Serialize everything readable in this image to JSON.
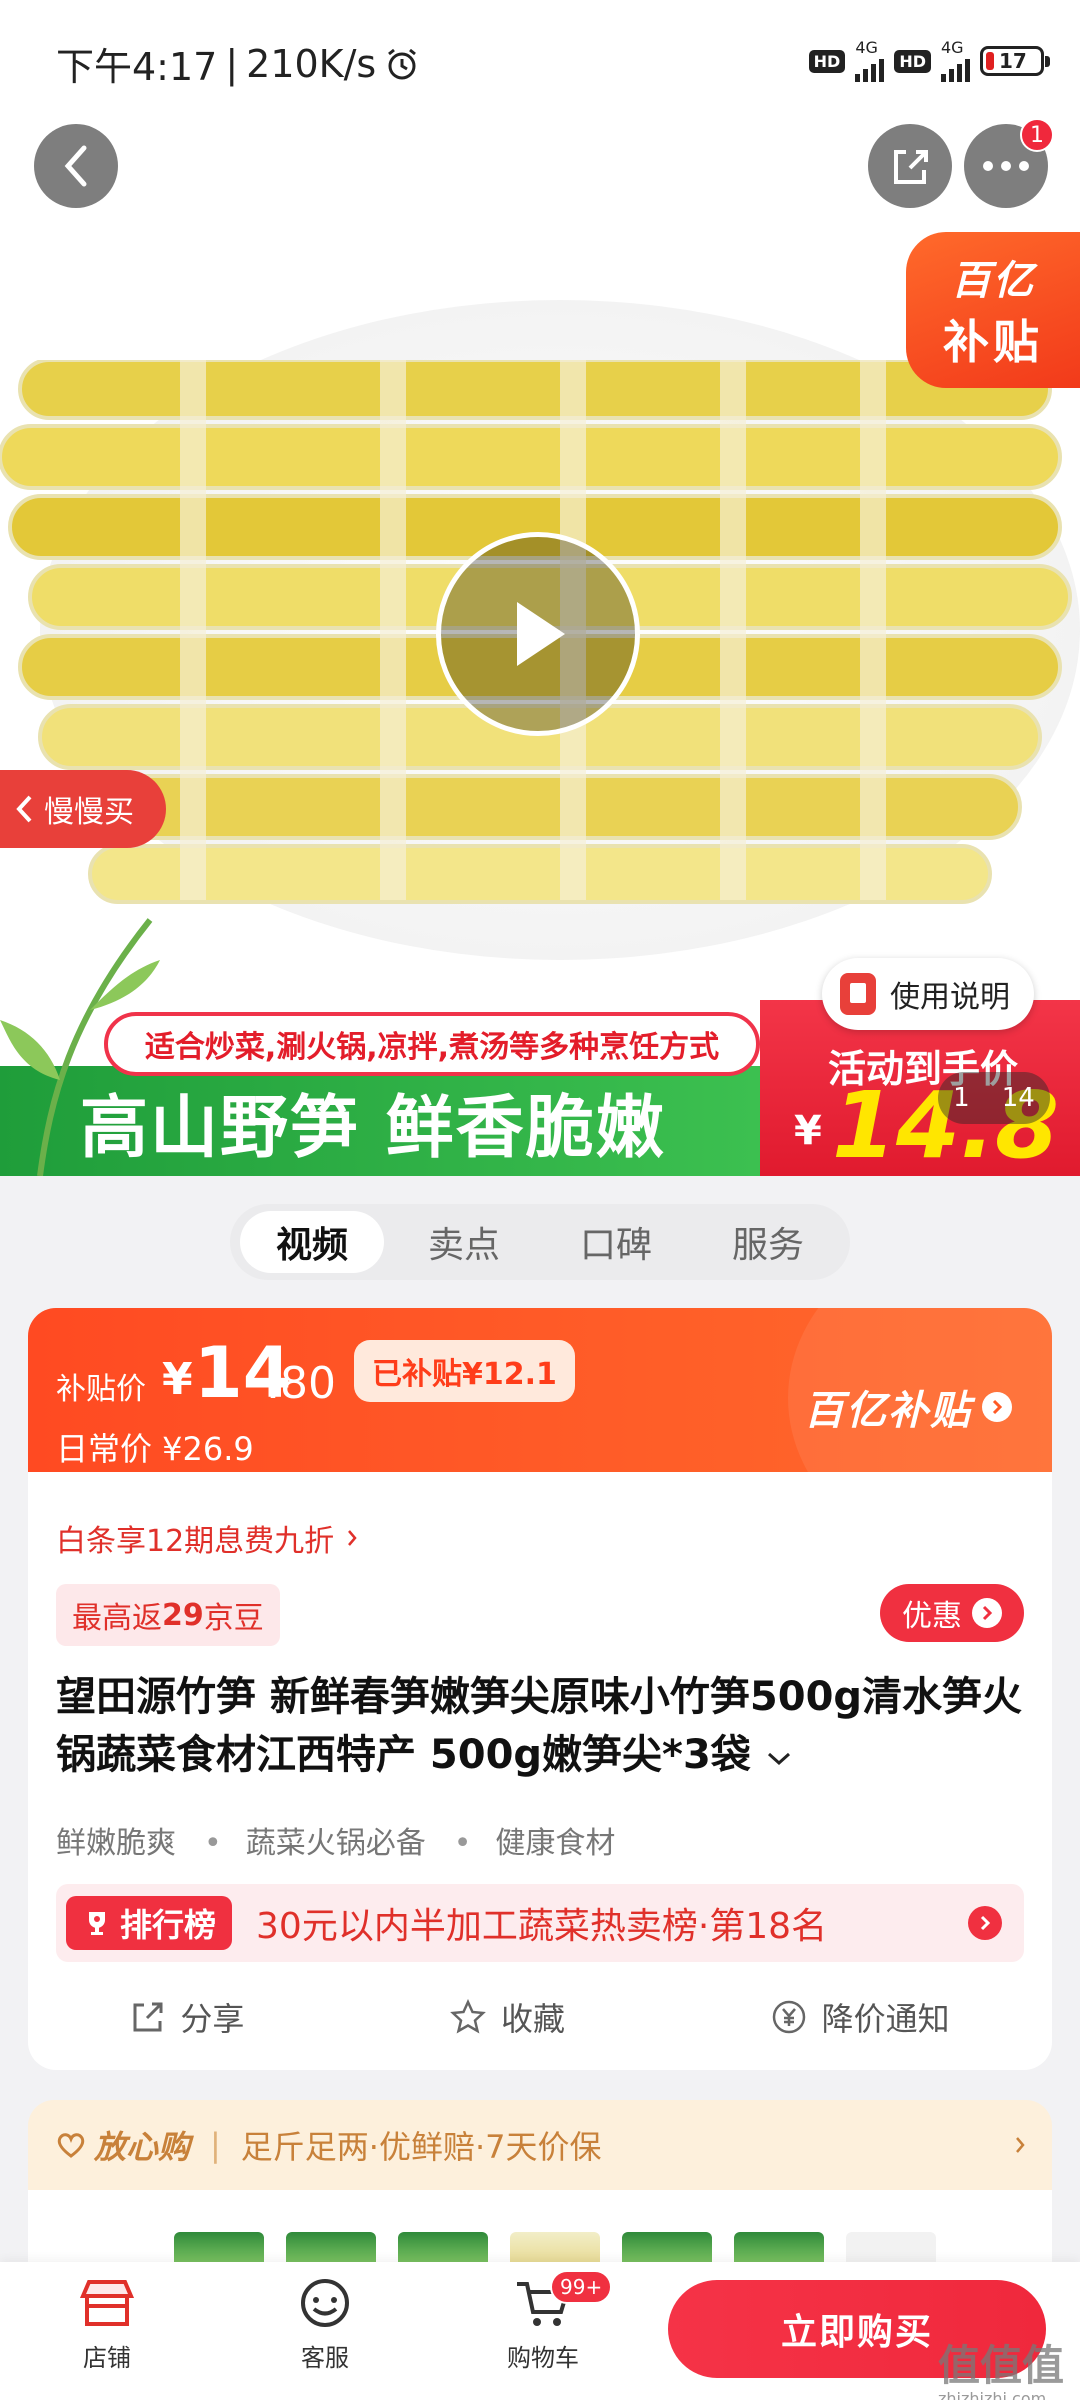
{
  "status": {
    "time": "下午4:17",
    "speed": "210K/s",
    "battery": "17",
    "net1": "4G",
    "net2": "4G",
    "hd": "HD"
  },
  "header": {
    "more_badge": "1"
  },
  "hero": {
    "corner_line1": "百亿",
    "corner_line2": "补贴",
    "slow_buy": "慢慢买",
    "banner_top": "适合炒菜,涮火锅,凉拌,煮汤等多种烹饪方式",
    "banner_main": "高山野笋 鲜香脆嫩",
    "promo_title": "活动到手价",
    "promo_yen": "¥",
    "promo_price": "14.8",
    "usage_label": "使用说明",
    "counter_current": "1",
    "counter_total": "14"
  },
  "tabs": [
    "视频",
    "卖点",
    "口碑",
    "服务"
  ],
  "price": {
    "subsidy_label": "补贴价",
    "yen": "¥",
    "int": "14",
    "dec": ".80",
    "saved": "已补贴¥12.1",
    "regular": "日常价 ¥26.9",
    "brand": "百亿补贴"
  },
  "product": {
    "baitiao": "白条享12期息费九折",
    "jingdou_prefix": "最高返",
    "jingdou_num": "29",
    "jingdou_suffix": "京豆",
    "coupon": "优惠",
    "title": "望田源竹笋 新鲜春笋嫩笋尖原味小竹笋500g清水笋火锅蔬菜食材江西特产 500g嫩笋尖*3袋",
    "tags": [
      "鲜嫩脆爽",
      "蔬菜火锅必备",
      "健康食材"
    ],
    "rank_badge": "排行榜",
    "rank_text": "30元以内半加工蔬菜热卖榜·第18名",
    "actions": {
      "share": "分享",
      "favorite": "收藏",
      "price_alert": "降价通知"
    }
  },
  "assurance": {
    "brand": "放心购",
    "text": "足斤足两·优鲜赔·7天价保"
  },
  "bottom": {
    "shop": "店铺",
    "service": "客服",
    "cart": "购物车",
    "cart_badge": "99+",
    "buy": "立即购买"
  },
  "watermark": {
    "main": "值值值",
    "sub": "zhizhizhi.com"
  }
}
